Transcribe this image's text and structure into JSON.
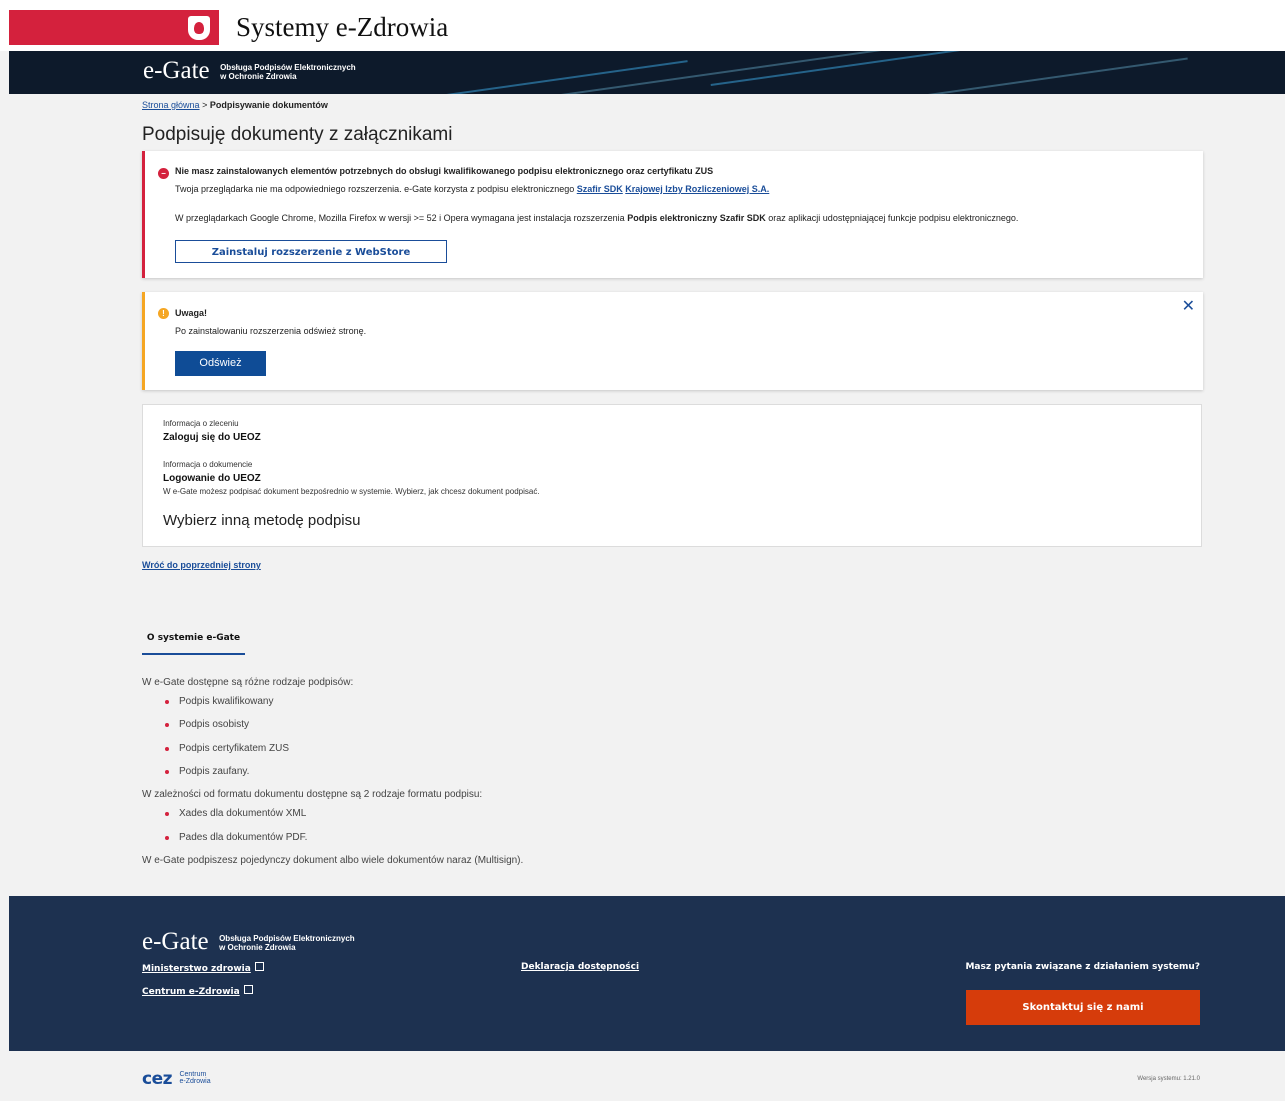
{
  "header": {
    "gov_title": "Systemy e-Zdrowia",
    "logo_word": "e-Gate",
    "logo_sub_1": "Obsługa Podpisów Elektronicznych",
    "logo_sub_2": "w Ochronie Zdrowia"
  },
  "breadcrumb": {
    "home": "Strona główna",
    "separator": ">",
    "current": "Podpisywanie dokumentów"
  },
  "page_title": "Podpisuję dokumenty z załącznikami",
  "error_alert": {
    "title": "Nie masz zainstalowanych elementów potrzebnych do obsługi kwalifikowanego podpisu elektronicznego oraz certyfikatu ZUS",
    "line1_text": "Twoja przeglądarka nie ma odpowiedniego rozszerzenia. e-Gate korzysta z podpisu elektronicznego",
    "link1": "Szafir SDK",
    "link2": "Krajowej Izby Rozliczeniowej S.A.",
    "line2_a": "W przeglądarkach Google Chrome, Mozilla Firefox w wersji >= 52 i Opera wymagana jest instalacja rozszerzenia",
    "line2_bold": "Podpis elektroniczny Szafir SDK",
    "line2_b": "oraz aplikacji udostępniającej funkcje podpisu elektronicznego.",
    "button": "Zainstaluj rozszerzenie z WebStore"
  },
  "warning_alert": {
    "title": "Uwaga!",
    "text": "Po zainstalowaniu rozszerzenia odśwież stronę.",
    "button": "Odśwież",
    "close": "✕"
  },
  "info": {
    "order_label": "Informacja o zleceniu",
    "order_value": "Zaloguj się do UEOZ",
    "doc_label": "Informacja o dokumencie",
    "doc_value": "Logowanie do UEOZ",
    "doc_desc": "W e-Gate możesz podpisać dokument bezpośrednio w systemie. Wybierz, jak chcesz dokument podpisać.",
    "method": "Wybierz inną metodę podpisu"
  },
  "back_link": "Wróć do poprzedniej strony",
  "about": {
    "tab": "O systemie e-Gate",
    "intro": "W e-Gate dostępne są różne rodzaje podpisów:",
    "signatures": [
      "Podpis kwalifikowany",
      "Podpis osobisty",
      "Podpis certyfikatem ZUS",
      "Podpis zaufany."
    ],
    "formats_intro": "W zależności od formatu dokumentu dostępne są 2 rodzaje formatu podpisu:",
    "formats": [
      "Xades dla dokumentów XML",
      "Pades dla dokumentów PDF."
    ],
    "outro": "W e-Gate podpiszesz pojedynczy dokument albo wiele dokumentów naraz (Multisign)."
  },
  "footer": {
    "link_ministry": "Ministerstwo zdrowia",
    "link_centrum": "Centrum e-Zdrowia",
    "link_declaration": "Deklaracja dostępności",
    "question": "Masz pytania związane z działaniem systemu?",
    "contact_button": "Skontaktuj się z nami"
  },
  "bottom": {
    "cez_word": "cez",
    "cez_sub_1": "Centrum",
    "cez_sub_2": "e-Zdrowia",
    "version": "Wersja systemu: 1.21.0"
  },
  "colors": {
    "gov_red": "#d4213d",
    "brand_dark": "#0d1a2b",
    "link_blue": "#1a4d99",
    "primary_button": "#0f4c96",
    "warning": "#f5a623",
    "footer_bg": "#1d3150",
    "contact_button": "#d63c0b"
  }
}
